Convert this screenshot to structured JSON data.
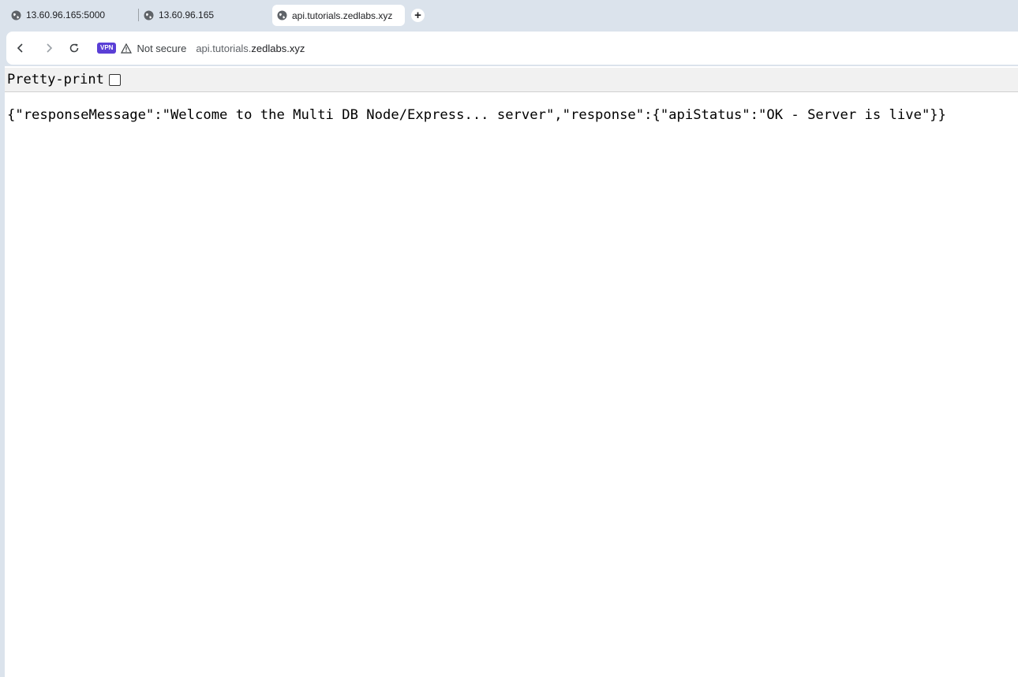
{
  "browser": {
    "tabs": [
      {
        "title": "13.60.96.165:5000",
        "icon": "globe-icon",
        "active": false
      },
      {
        "title": "13.60.96.165",
        "icon": "globe-icon",
        "active": false
      },
      {
        "title": "api.tutorials.zedlabs.xyz",
        "icon": "globe-icon",
        "active": true
      }
    ],
    "new_tab_label": "+",
    "toolbar": {
      "vpn_label": "VPN",
      "security_label": "Not secure",
      "url_prefix": "api.tutorials.",
      "url_domain": "zedlabs.xyz"
    },
    "colors": {
      "frame": "#dbe3ec",
      "vpn": "#5a3fd6"
    }
  },
  "page": {
    "pretty_print_label": "Pretty-print",
    "pretty_print_checked": false,
    "json_text": "{\"responseMessage\":\"Welcome to the Multi DB Node/Express... server\",\"response\":{\"apiStatus\":\"OK - Server is live\"}}"
  }
}
